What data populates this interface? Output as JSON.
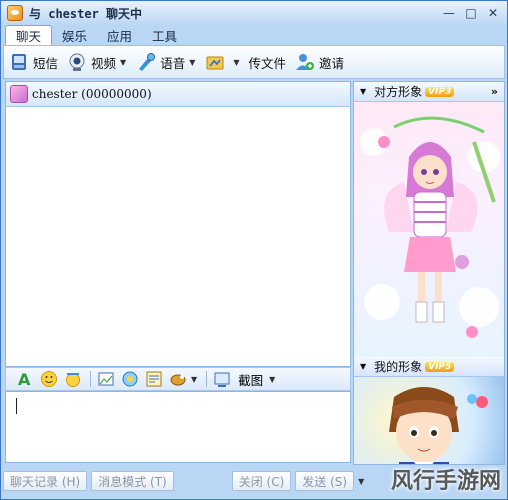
{
  "titlebar": {
    "title": "与 chester 聊天中",
    "minimize": "—",
    "maximize": "□",
    "close": "✕"
  },
  "menu": {
    "tabs": [
      "聊天",
      "娱乐",
      "应用",
      "工具"
    ],
    "active": "聊天"
  },
  "toolbar": {
    "sms": "短信",
    "video": "视频",
    "voice": "语音",
    "send_file": "传文件",
    "invite": "邀请"
  },
  "chat": {
    "contact": "chester (00000000)"
  },
  "input_toolbar": {
    "screenshot": "截图"
  },
  "bottom": {
    "history": "聊天记录 (H)",
    "msg_mode": "消息模式 (T)",
    "close": "关闭 (C)",
    "send": "发送 (S)"
  },
  "side": {
    "partner_title": "对方形象",
    "partner_badge": "VIP3",
    "mine_title": "我的形象",
    "mine_badge": "VIP5"
  },
  "watermark": "风行手游网",
  "colors": {
    "window_bg": "#b9d6f5",
    "border": "#3b76c9",
    "vip_badge": "#f39c12"
  }
}
